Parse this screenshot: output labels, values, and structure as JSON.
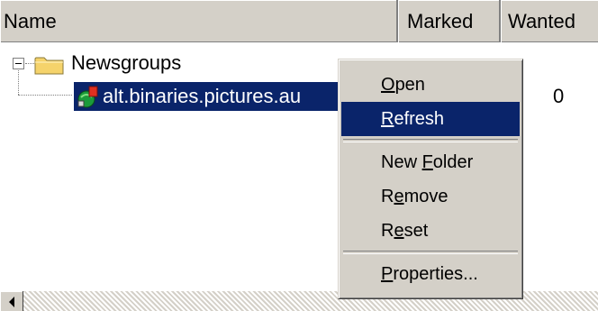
{
  "columns": {
    "name": "Name",
    "marked": "Marked",
    "wanted": "Wanted"
  },
  "tree": {
    "root_label": "Newsgroups",
    "root_icon": "folder-icon",
    "child_label": "alt.binaries.pictures.au",
    "child_icon": "newsgroup-icon",
    "child_wanted": "0"
  },
  "context_menu": {
    "items": [
      {
        "label": "Open",
        "accel": "O"
      },
      {
        "label": "Refresh",
        "accel": "R"
      },
      {
        "label": "New Folder",
        "accel": "F"
      },
      {
        "label": "Remove",
        "accel": "e"
      },
      {
        "label": "Reset",
        "accel": "e"
      },
      {
        "label": "Properties...",
        "accel": "P"
      }
    ]
  },
  "colors": {
    "selection": "#0a246a",
    "face": "#d4d0c8",
    "folder": "#f5d36b"
  }
}
